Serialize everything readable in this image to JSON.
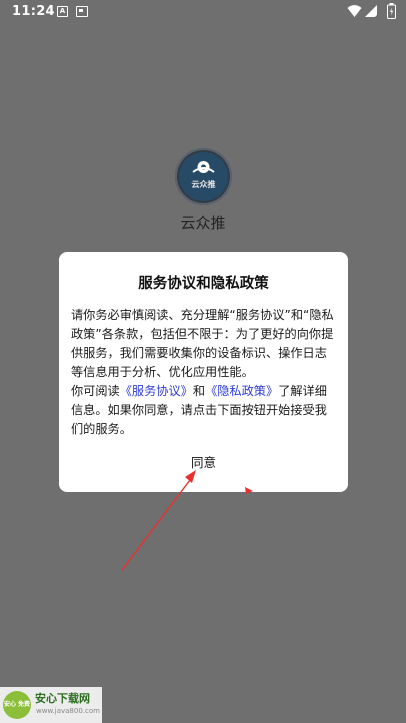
{
  "status_bar": {
    "time": "11:24",
    "icon_a_letter": "A",
    "icons": [
      "notification-a-icon",
      "notification-image-icon",
      "wifi-icon",
      "signal-icon",
      "battery-icon"
    ]
  },
  "app": {
    "logo_text": "云众推",
    "name": "云众推"
  },
  "dialog": {
    "title": "服务协议和隐私政策",
    "para1": "请你务必审慎阅读、充分理解“服务协议”和“隐私政策”各条款，包括但不限于：为了更好的向你提供服务，我们需要收集你的设备标识、操作日志等信息用于分析、优化应用性能。",
    "para2_prefix": "你可阅读",
    "link_service": "《服务协议》",
    "para2_and": "和",
    "link_privacy": "《隐私政策》",
    "para2_suffix": "了解详细信息。如果你同意，请点击下面按钮开始接受我们的服务。",
    "agree_label": "同意"
  },
  "watermark": {
    "logo_text": "安心 免费",
    "title": "安心下载网",
    "site": "www.java800.com"
  },
  "colors": {
    "overlay_background": "#6f6f6f",
    "dialog_background": "#ffffff",
    "link": "#2d3bd6",
    "annotation": "#e8312f"
  }
}
